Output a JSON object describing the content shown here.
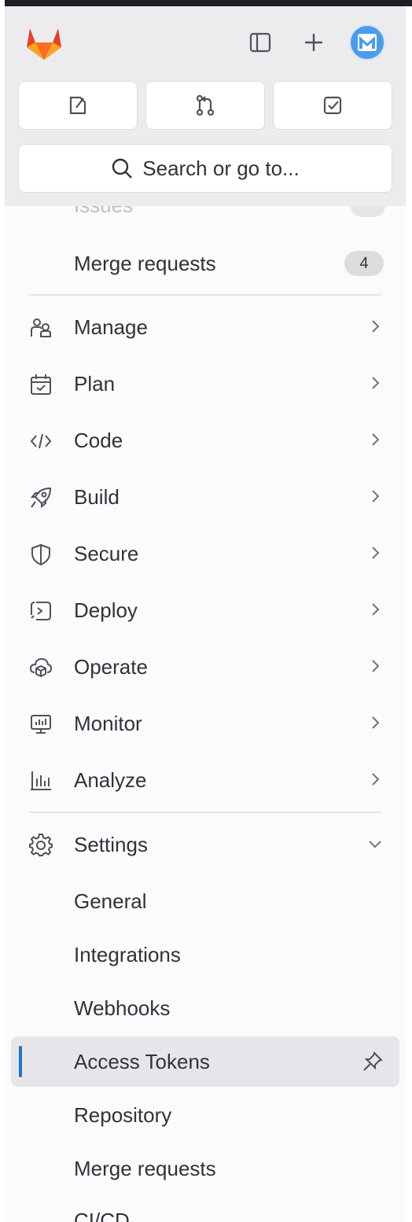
{
  "header": {
    "logo": "gitlab-tanuki-logo",
    "toggle_sidebar_icon": "sidebar-toggle-icon",
    "create_new_icon": "plus-icon",
    "avatar_icon": "user-avatar"
  },
  "shortcuts": [
    {
      "name": "issues",
      "icon": "issues-icon"
    },
    {
      "name": "merge-requests",
      "icon": "merge-request-icon"
    },
    {
      "name": "todos",
      "icon": "todo-check-icon"
    }
  ],
  "search": {
    "label": "Search or go to..."
  },
  "nav": {
    "partial_item": {
      "label": "Issues"
    },
    "merge_requests": {
      "label": "Merge requests",
      "count": "4"
    },
    "groups": [
      {
        "label": "Manage",
        "icon": "users-icon"
      },
      {
        "label": "Plan",
        "icon": "calendar-icon"
      },
      {
        "label": "Code",
        "icon": "code-icon"
      },
      {
        "label": "Build",
        "icon": "rocket-icon"
      },
      {
        "label": "Secure",
        "icon": "shield-icon"
      },
      {
        "label": "Deploy",
        "icon": "deploy-icon"
      },
      {
        "label": "Operate",
        "icon": "cloud-gear-icon"
      },
      {
        "label": "Monitor",
        "icon": "monitor-icon"
      },
      {
        "label": "Analyze",
        "icon": "chart-icon"
      }
    ],
    "settings": {
      "label": "Settings",
      "icon": "gear-icon",
      "expanded": true,
      "items": [
        {
          "label": "General"
        },
        {
          "label": "Integrations"
        },
        {
          "label": "Webhooks"
        },
        {
          "label": "Access Tokens",
          "active": true
        },
        {
          "label": "Repository"
        },
        {
          "label": "Merge requests"
        },
        {
          "label": "CI/CD"
        }
      ]
    }
  },
  "colors": {
    "active_indicator": "#1f75cb",
    "sidebar_bg": "#fbfafd",
    "header_bg": "#ececef"
  }
}
